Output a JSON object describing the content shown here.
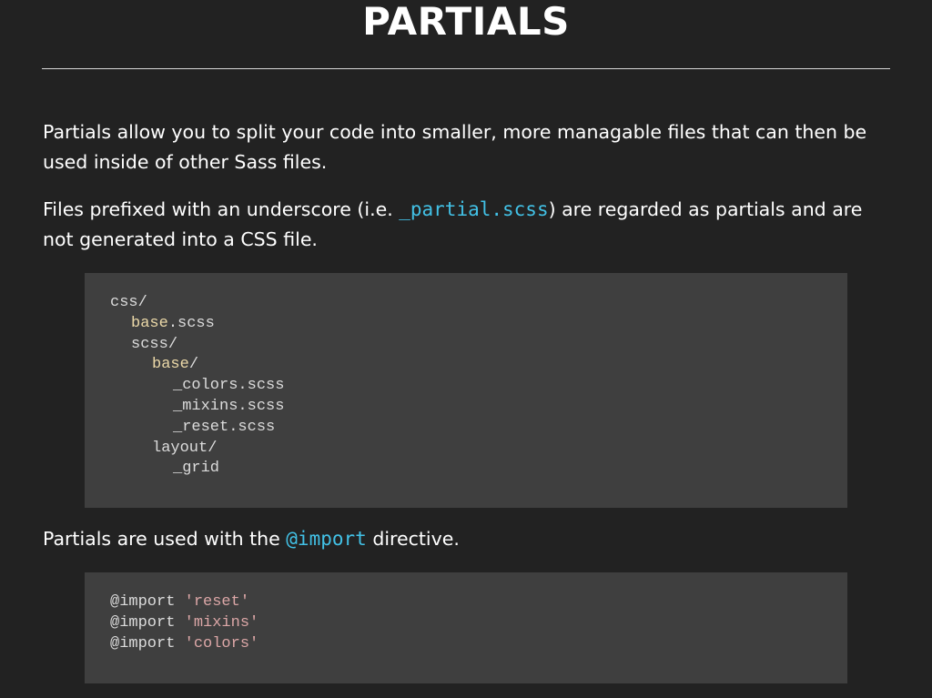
{
  "slide": {
    "title": "PARTIALS"
  },
  "intro": {
    "p1": "Partials allow you to split your code into smaller, more managable files that can then be used inside of other Sass files.",
    "p2_before": "Files prefixed with an underscore (i.e. ",
    "p2_code": "_partial.scss",
    "p2_after": ") are regarded as partials and are not generated into a CSS file.",
    "p3_before": "Partials are used with the ",
    "p3_code": "@import",
    "p3_after": " directive."
  },
  "tree": {
    "lines": [
      {
        "name": "css",
        "suffix": "/"
      },
      {
        "name": "base",
        "suffix": ".scss"
      },
      {
        "name": "scss",
        "suffix": "/"
      },
      {
        "name": "base",
        "suffix": "/"
      },
      {
        "name": "_colors",
        "suffix": ".scss"
      },
      {
        "name": "_mixins",
        "suffix": ".scss"
      },
      {
        "name": "_reset",
        "suffix": ".scss"
      },
      {
        "name": "layout",
        "suffix": "/"
      },
      {
        "name": "_grid",
        "suffix": ""
      }
    ]
  },
  "imports": {
    "keyword": "@import",
    "items": [
      "'reset'",
      "'mixins'",
      "'colors'"
    ]
  },
  "colors": {
    "background": "#222222",
    "code_background": "#3f3f3f",
    "inline_code": "#42c1e6",
    "directory_highlight": "#ecd9a8",
    "string": "#dca7a7"
  }
}
